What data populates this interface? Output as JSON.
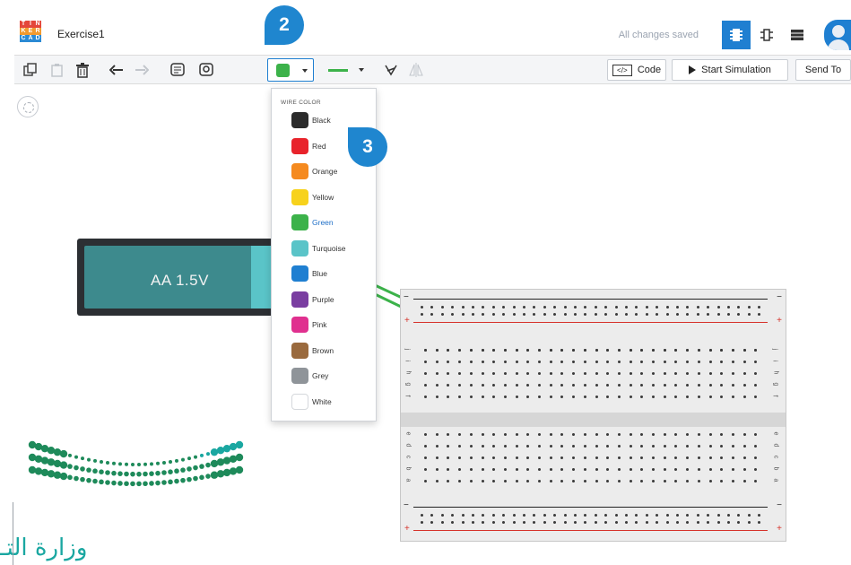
{
  "header": {
    "logo_letters": [
      "T",
      "I",
      "N",
      "K",
      "E",
      "R",
      "C",
      "A",
      "D"
    ],
    "project_name": "Exercise1",
    "save_status": "All changes saved",
    "accent": "#1f7fd1"
  },
  "toolbar": {
    "icons": [
      "copy-icon",
      "paste-icon",
      "delete-icon",
      "undo-icon",
      "redo-icon",
      "notes-icon",
      "toggle-notes-icon",
      "wire-color-dropdown",
      "wire-type-dropdown",
      "flip-icon",
      "mirror-icon"
    ],
    "selected_wire_color": "#3cb24a",
    "code_label": "Code",
    "start_simulation_label": "Start Simulation",
    "send_to_label": "Send To"
  },
  "wire_color_menu": {
    "title": "WIRE COLOR",
    "selected": "Green",
    "items": [
      {
        "label": "Black",
        "color": "#2b2b2b"
      },
      {
        "label": "Red",
        "color": "#e8232b"
      },
      {
        "label": "Orange",
        "color": "#f58a1f"
      },
      {
        "label": "Yellow",
        "color": "#f7d21c"
      },
      {
        "label": "Green",
        "color": "#3cb24a"
      },
      {
        "label": "Turquoise",
        "color": "#5ac4c8"
      },
      {
        "label": "Blue",
        "color": "#1f7fd1"
      },
      {
        "label": "Purple",
        "color": "#7a3ea1"
      },
      {
        "label": "Pink",
        "color": "#e0308f"
      },
      {
        "label": "Brown",
        "color": "#9a6a3e"
      },
      {
        "label": "Grey",
        "color": "#8f9499"
      },
      {
        "label": "White",
        "color": "#ffffff"
      }
    ]
  },
  "battery": {
    "label": "AA 1.5V"
  },
  "breadboard": {
    "top_letters": [
      "j",
      "i",
      "h",
      "g",
      "f"
    ],
    "bottom_letters": [
      "e",
      "d",
      "c",
      "b",
      "a"
    ],
    "columns": 30
  },
  "callouts": {
    "step_2": "2",
    "step_3": "3"
  },
  "watermark": {
    "text": "وزارة التـ"
  }
}
